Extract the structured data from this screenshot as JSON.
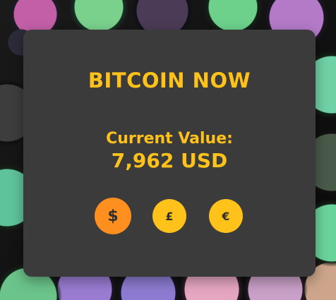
{
  "widget": {
    "title": "BITCOIN NOW",
    "current_value_label": "Current Value:",
    "current_value": "7,962 USD",
    "currency_buttons": [
      {
        "symbol": "$",
        "color": "#ff8f1f",
        "selected": true
      },
      {
        "symbol": "£",
        "color": "#ffc21b",
        "selected": false
      },
      {
        "symbol": "€",
        "color": "#ffc21b",
        "selected": false
      }
    ]
  },
  "colors": {
    "accent": "#ffc21b",
    "selected_accent": "#ff8f1f",
    "card_background": "#3b3b3b",
    "button_text": "#2f2f2f"
  }
}
